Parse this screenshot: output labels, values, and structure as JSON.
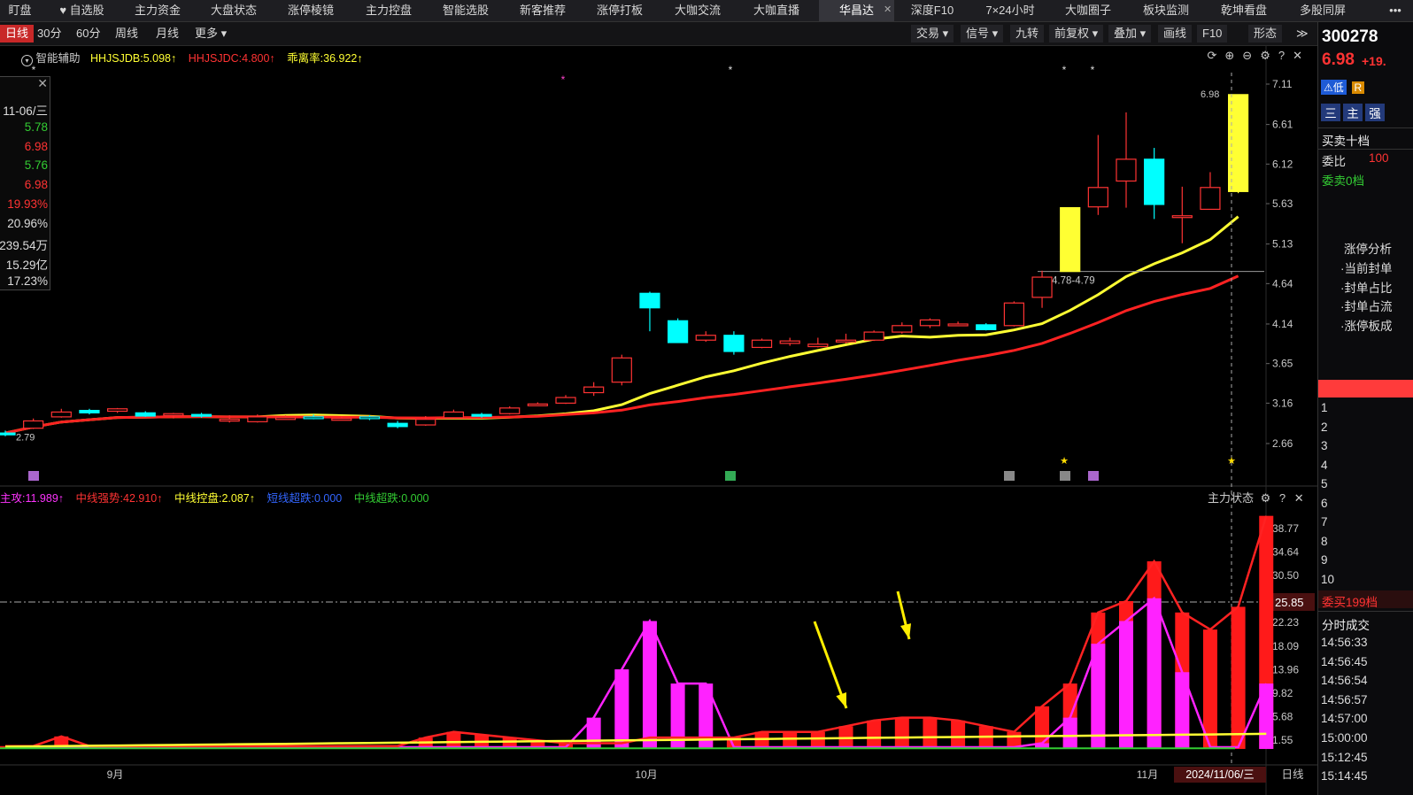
{
  "top_tabs": [
    {
      "label": "盯盘",
      "active": false
    },
    {
      "label": "♥ 自选股",
      "active": false
    },
    {
      "label": "主力资金",
      "active": false
    },
    {
      "label": "大盘状态",
      "active": false
    },
    {
      "label": "涨停棱镜",
      "active": false
    },
    {
      "label": "主力控盘",
      "active": false
    },
    {
      "label": "智能选股",
      "active": false
    },
    {
      "label": "新客推荐",
      "active": false
    },
    {
      "label": "涨停打板",
      "active": false
    },
    {
      "label": "大咖交流",
      "active": false
    },
    {
      "label": "大咖直播",
      "active": false
    },
    {
      "label": "华昌达",
      "active": true
    },
    {
      "label": "深度F10",
      "active": false
    },
    {
      "label": "7×24小时",
      "active": false
    },
    {
      "label": "大咖圈子",
      "active": false
    },
    {
      "label": "板块监测",
      "active": false
    },
    {
      "label": "乾坤看盘",
      "active": false
    },
    {
      "label": "多股同屏",
      "active": false
    }
  ],
  "top_more": "•••",
  "periods": [
    {
      "label": "日线",
      "active": true
    },
    {
      "label": "30分",
      "active": false
    },
    {
      "label": "60分",
      "active": false
    },
    {
      "label": "周线",
      "active": false
    },
    {
      "label": "月线",
      "active": false
    },
    {
      "label": "更多 ▾",
      "active": false
    }
  ],
  "tools": [
    "交易 ▾",
    "信号 ▾",
    "九转",
    "前复权 ▾",
    "叠加 ▾",
    "画线",
    "F10",
    "形态"
  ],
  "tools_more": "≫",
  "main_indicator": {
    "name": "智能辅助",
    "items": [
      {
        "text": "HHJSJDB:5.098↑",
        "color": "#ffff33"
      },
      {
        "text": "HHJSJDC:4.800↑",
        "color": "#ff3333"
      },
      {
        "text": "乖离率:36.922↑",
        "color": "#ffff33"
      }
    ]
  },
  "info_box": {
    "date": "11-06/三",
    "rows": [
      {
        "v": "5.78",
        "c": "#33cc33"
      },
      {
        "v": "6.98",
        "c": "#ff3333"
      },
      {
        "v": "5.76",
        "c": "#33cc33"
      },
      {
        "v": "6.98",
        "c": "#ff3333"
      },
      {
        "v": "19.93%",
        "c": "#ff3333"
      },
      {
        "v": "20.96%",
        "c": "#dddddd"
      },
      {
        "v": "239.54万",
        "c": "#dddddd"
      },
      {
        "v": "15.29亿",
        "c": "#dddddd"
      },
      {
        "v": "17.23%",
        "c": "#dddddd"
      }
    ]
  },
  "price_axis": [
    "7.11",
    "6.61",
    "6.12",
    "5.63",
    "5.13",
    "4.64",
    "4.14",
    "3.65",
    "3.16",
    "2.66"
  ],
  "price_labels": {
    "high": "6.98",
    "low": "2.79",
    "support": "4.78-4.79"
  },
  "sub_indicator": {
    "name": "主力状态",
    "items": [
      {
        "text": "主攻:11.989↑",
        "color": "#ff33ff"
      },
      {
        "text": "中线强势:42.910↑",
        "color": "#ff3333"
      },
      {
        "text": "中线控盘:2.087↑",
        "color": "#ffff33"
      },
      {
        "text": "短线超跌:0.000",
        "color": "#3366ff"
      },
      {
        "text": "中线超跌:0.000",
        "color": "#33cc33"
      }
    ]
  },
  "sub_axis": [
    "38.77",
    "34.64",
    "30.50",
    "22.23",
    "18.09",
    "13.96",
    "9.82",
    "5.68",
    "1.55"
  ],
  "sub_marker": "25.85",
  "x_axis": {
    "labels": [
      "9月",
      "10月",
      "11月"
    ],
    "cursor_date": "2024/11/06/三",
    "period": "日线"
  },
  "right_panel": {
    "code": "300278",
    "price": "6.98",
    "change": "+19.",
    "badges": [
      "低",
      "R"
    ],
    "btns": [
      "三",
      "主",
      "强"
    ],
    "book_title": "买卖十档",
    "weibi_label": "委比",
    "weibi_value": "100",
    "sell_zero": "委卖0档",
    "limit_title": "涨停分析",
    "limit_items": [
      "·当前封单",
      "·封单占比",
      "·封单占流",
      "·涨停板成"
    ],
    "buy_levels": [
      "1",
      "2",
      "3",
      "4",
      "5",
      "6",
      "7",
      "8",
      "9",
      "10"
    ],
    "buy_summary": "委买199档",
    "trades_title": "分时成交",
    "trade_times": [
      "14:56:33",
      "14:56:45",
      "14:56:54",
      "14:56:57",
      "14:57:00",
      "15:00:00",
      "15:12:45",
      "15:14:45"
    ]
  },
  "chart_data": {
    "type": "candlestick",
    "colors": {
      "up": "#ff3333",
      "down": "#00ffff",
      "limit": "#ffff33",
      "ma_fast": "#ffff33",
      "ma_slow": "#ff2222"
    },
    "candles": [
      [
        2.79,
        2.79,
        2.82,
        2.75,
        "down"
      ],
      [
        2.85,
        2.94,
        2.97,
        2.84,
        "up"
      ],
      [
        2.99,
        3.05,
        3.09,
        2.98,
        "up"
      ],
      [
        3.07,
        3.04,
        3.09,
        3.02,
        "down"
      ],
      [
        3.06,
        3.09,
        3.1,
        3.04,
        "up"
      ],
      [
        3.04,
        3.0,
        3.06,
        2.99,
        "down"
      ],
      [
        3.01,
        3.03,
        3.04,
        2.97,
        "up"
      ],
      [
        3.02,
        3.01,
        3.04,
        2.98,
        "down"
      ],
      [
        2.96,
        2.96,
        3.01,
        2.92,
        "flat"
      ],
      [
        2.93,
        2.99,
        3.02,
        2.92,
        "up"
      ],
      [
        2.98,
        2.98,
        3.01,
        2.96,
        "flat"
      ],
      [
        2.99,
        2.98,
        3.02,
        2.96,
        "flat"
      ],
      [
        2.97,
        2.97,
        2.99,
        2.95,
        "flat"
      ],
      [
        2.99,
        2.97,
        3.01,
        2.95,
        "flat"
      ],
      [
        2.91,
        2.87,
        2.94,
        2.85,
        "down"
      ],
      [
        2.89,
        2.96,
        3.0,
        2.88,
        "up"
      ],
      [
        2.98,
        3.05,
        3.08,
        2.97,
        "up"
      ],
      [
        3.02,
        3.0,
        3.04,
        2.98,
        "down"
      ],
      [
        3.03,
        3.1,
        3.12,
        3.02,
        "up"
      ],
      [
        3.15,
        3.15,
        3.17,
        3.13,
        "flat"
      ],
      [
        3.16,
        3.23,
        3.26,
        3.15,
        "up"
      ],
      [
        3.29,
        3.36,
        3.42,
        3.25,
        "up"
      ],
      [
        3.42,
        3.72,
        3.76,
        3.38,
        "up"
      ],
      [
        4.52,
        4.34,
        4.54,
        4.05,
        "down"
      ],
      [
        4.18,
        3.91,
        4.21,
        3.91,
        "down"
      ],
      [
        3.94,
        4.0,
        4.05,
        3.92,
        "up"
      ],
      [
        4.0,
        3.8,
        4.05,
        3.76,
        "down"
      ],
      [
        3.85,
        3.94,
        3.96,
        3.84,
        "up"
      ],
      [
        3.9,
        3.93,
        3.97,
        3.87,
        "flat"
      ],
      [
        3.86,
        3.89,
        3.97,
        3.85,
        "up"
      ],
      [
        3.92,
        3.94,
        4.02,
        3.9,
        "up"
      ],
      [
        3.94,
        4.04,
        4.06,
        3.93,
        "up"
      ],
      [
        4.04,
        4.12,
        4.16,
        4.02,
        "up"
      ],
      [
        4.12,
        4.19,
        4.21,
        4.09,
        "up"
      ],
      [
        4.14,
        4.14,
        4.17,
        4.12,
        "flat"
      ],
      [
        4.13,
        4.07,
        4.15,
        4.06,
        "down"
      ],
      [
        4.12,
        4.4,
        4.42,
        4.11,
        "up"
      ],
      [
        4.47,
        4.72,
        4.8,
        4.34,
        "up"
      ],
      [
        4.79,
        5.58,
        5.58,
        4.79,
        "limit"
      ],
      [
        5.59,
        5.83,
        6.48,
        5.49,
        "up"
      ],
      [
        5.91,
        6.18,
        6.76,
        5.58,
        "up"
      ],
      [
        6.18,
        5.62,
        6.32,
        5.44,
        "down"
      ],
      [
        5.48,
        5.48,
        5.84,
        5.14,
        "flat"
      ],
      [
        5.56,
        5.83,
        6.02,
        5.56,
        "up"
      ],
      [
        5.78,
        6.98,
        6.98,
        5.76,
        "limit"
      ]
    ],
    "sub_bars_red": [
      0.5,
      0.5,
      2.2,
      0.5,
      0.5,
      0.5,
      0.5,
      0.5,
      0.5,
      0.5,
      0.5,
      0.5,
      0.5,
      0.5,
      0.5,
      2.0,
      3.0,
      2.5,
      2.0,
      1.5,
      1.0,
      1.0,
      1.0,
      2.0,
      2.0,
      2.0,
      2.0,
      3.0,
      3.0,
      3.0,
      4.0,
      5.0,
      5.5,
      5.5,
      5.0,
      4.0,
      3.0,
      7.5,
      11.5,
      24.0,
      26.0,
      33.0,
      24.0,
      21.0,
      25.0,
      41.0
    ],
    "sub_bars_mag": [
      0,
      0,
      0,
      0,
      0,
      0,
      0,
      0,
      0,
      0,
      0,
      0,
      0,
      0,
      0,
      0,
      0,
      0,
      0,
      0,
      0,
      5.5,
      14.0,
      22.5,
      11.5,
      11.5,
      0,
      0,
      0,
      0,
      0,
      0,
      0,
      0,
      0,
      0,
      0,
      1.0,
      5.5,
      18.5,
      22.5,
      26.5,
      13.5,
      0,
      0,
      11.5
    ]
  }
}
